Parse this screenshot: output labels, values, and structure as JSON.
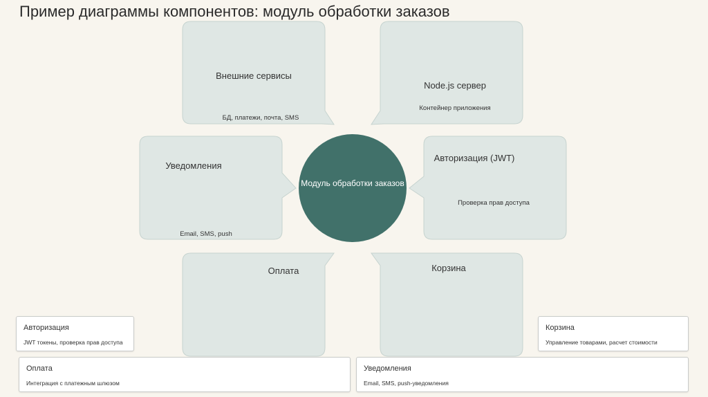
{
  "title": "Пример диаграммы компонентов: модуль обработки заказов",
  "center": {
    "label": "Модуль обработки заказов"
  },
  "components": {
    "external": {
      "label": "Внешние сервисы",
      "desc": "БД, платежи, почта, SMS"
    },
    "node": {
      "label": "Node.js сервер",
      "desc": "Контейнер приложения"
    },
    "notifications": {
      "label": "Уведомления",
      "desc": "Email, SMS, push"
    },
    "auth": {
      "label": "Авторизация (JWT)",
      "desc": "Проверка прав доступа"
    },
    "payment": {
      "label": "Оплата"
    },
    "cart": {
      "label": "Корзина"
    }
  },
  "cards": {
    "auth": {
      "title": "Авторизация",
      "desc": "JWT токены, проверка прав доступа"
    },
    "cart": {
      "title": "Корзина",
      "desc": "Управление товарами, расчет стоимости"
    },
    "payment": {
      "title": "Оплата",
      "desc": "Интеграция с платежным шлюзом"
    },
    "notifications": {
      "title": "Уведомления",
      "desc": "Email, SMS, push-уведомления"
    }
  },
  "colors": {
    "background": "#f8f5ee",
    "bubble_fill": "#dfe7e4",
    "bubble_stroke": "#c6d3cf",
    "center_fill": "#41716a"
  }
}
